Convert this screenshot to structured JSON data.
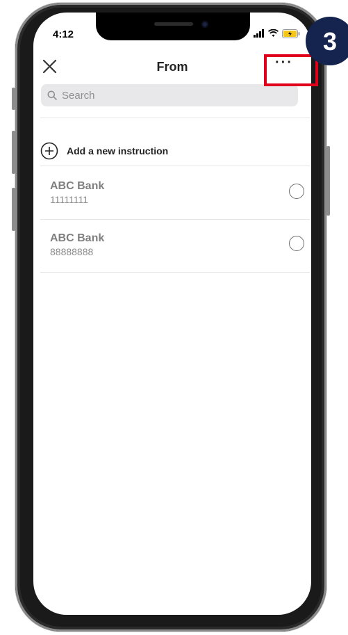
{
  "status_bar": {
    "time": "4:12"
  },
  "header": {
    "title": "From",
    "more_label": "···"
  },
  "search": {
    "placeholder": "Search"
  },
  "add_instruction": {
    "label": "Add a new instruction"
  },
  "accounts": [
    {
      "bank": "ABC Bank",
      "number": "11111111",
      "selected": false
    },
    {
      "bank": "ABC Bank",
      "number": "88888888",
      "selected": false
    }
  ],
  "overlay": {
    "step_number": "3",
    "badge_color": "#14244f",
    "highlight_color": "#e0001b"
  },
  "icons": [
    "close-icon",
    "more-icon",
    "search-icon",
    "plus-circle-icon",
    "signal-icon",
    "wifi-icon",
    "battery-icon"
  ]
}
